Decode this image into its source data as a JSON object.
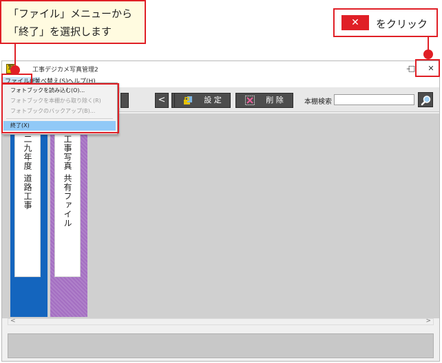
{
  "window": {
    "title": "工事デジカメ写真管理2",
    "app_icon_text": "写",
    "minimize_glyph": "–",
    "maximize_glyph": "□",
    "close_glyph": "✕"
  },
  "menubar": {
    "file": "ファイル(F)",
    "sort": "並べ替え(S)",
    "help": "ヘルプ(H)"
  },
  "file_menu": {
    "items": [
      {
        "label": "フォトブックを読み込む(O)...",
        "enabled": true
      },
      {
        "label": "フォトブックを本棚から取り除く(R)",
        "enabled": false
      },
      {
        "label": "フォトブックのバックアップ(B)...",
        "enabled": false
      },
      {
        "label": "終了(X)",
        "enabled": true,
        "highlighted": true
      }
    ]
  },
  "toolbar": {
    "prev_glyph": "<",
    "next_glyph": ">",
    "settings_label": "設 定",
    "delete_label": "削 除",
    "search_label": "本棚検索",
    "search_value": ""
  },
  "books": [
    {
      "title": "二九年度 道路工事",
      "color": "#1465be"
    },
    {
      "title": "工事写真 共有ファイル",
      "color": "#a46fc2"
    }
  ],
  "scroll": {
    "left_glyph": "<",
    "right_glyph": ">"
  },
  "annotations": {
    "callout_line1": "「ファイル」メニューから",
    "callout_line2": "「終了」を選択します",
    "close_callout_glyph": "✕",
    "close_callout_text": "をクリック",
    "accent_color": "#e01f26"
  }
}
